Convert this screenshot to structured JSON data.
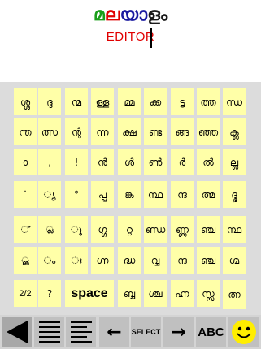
{
  "header": {
    "logo_glyphs": [
      {
        "text": "മ",
        "color": "#1a9e1a"
      },
      {
        "text": "ല",
        "color": "#e00000"
      },
      {
        "text": "യാ",
        "color": "#1a1aa0"
      },
      {
        "text": "ളം",
        "color": "#1a1a1a"
      }
    ],
    "subtitle": "EDITOR"
  },
  "keyboard": {
    "rows": [
      [
        "ശ്ശ",
        "ദ്ദ",
        "ന്മ",
        "ള്ള",
        "മ്മ",
        "ക്ക",
        "ട്ട",
        "ത്ത",
        "ന്ധ"
      ],
      [
        "ന്ത",
        "ത്സ",
        "ന്റ",
        "ന്ന",
        "ക്ഷ",
        "ണ്ട",
        "ങ്ങ",
        "ഞ്ഞ",
        "ക്ല"
      ],
      [
        "൦",
        ",",
        "!",
        "ൻ",
        "ൾ",
        "ൺ",
        "ർ",
        "ൽ",
        "ല്ല"
      ],
      [
        "˙",
        "ൃ",
        "°",
        "പ്പ",
        "ങ്ക",
        "ന്ഥ",
        "ന്ദ",
        "ത്മ",
        "ദ്ഭ"
      ],
      [
        "്",
        "്ല",
        "ൂ",
        "ഗ്ഗ",
        "റ്റ",
        "ണ്ഡ",
        "ണ്ണ",
        "ഞ്ച",
        "ന്ഥ"
      ],
      [
        "ൢ",
        "ം",
        "ഃ",
        "ഗ്ന",
        "ദ്ധ",
        "വ്വ",
        "ന്ദ",
        "ഞ്ച",
        "ഗ്മ"
      ],
      [
        "2/2",
        "?",
        "space",
        "ബ്ബ",
        "ശ്ച",
        "ഹ്ന",
        "സ്സ",
        "ത്ന"
      ]
    ]
  },
  "toolbar": {
    "back_icon": "back-triangle-icon",
    "justify_icon": "justify-lines-icon",
    "align_left_icon": "align-left-lines-icon",
    "left_arrow": "←",
    "select_label": "SELECT",
    "right_arrow": "→",
    "abc_label": "ABC",
    "smiley_icon": "smiley-icon",
    "smiley_color": "#ffee00"
  }
}
